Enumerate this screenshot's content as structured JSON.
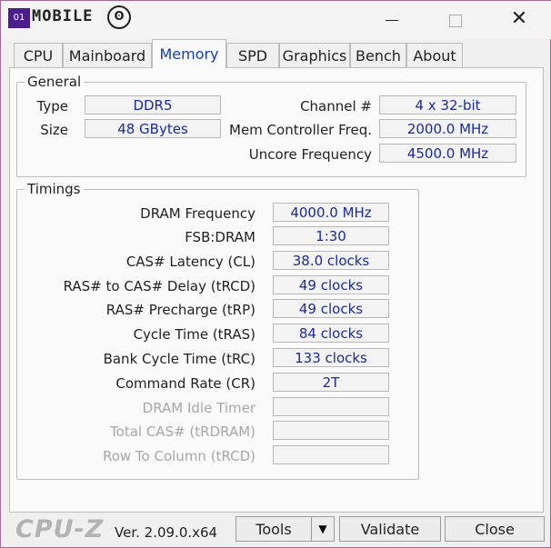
{
  "titlebar": {
    "logo_text": "MOBILE",
    "logo_mark": "01",
    "ring_glyph": "ʘ",
    "min_icon": "minimize-icon",
    "max_icon": "maximize-icon",
    "close_glyph": "✕"
  },
  "tabs": [
    "CPU",
    "Mainboard",
    "Memory",
    "SPD",
    "Graphics",
    "Bench",
    "About"
  ],
  "general": {
    "title": "General",
    "type_label": "Type",
    "type_value": "DDR5",
    "size_label": "Size",
    "size_value": "48 GBytes",
    "channel_label": "Channel #",
    "channel_value": "4 x 32-bit",
    "mcf_label": "Mem Controller Freq.",
    "mcf_value": "2000.0 MHz",
    "uncore_label": "Uncore Frequency",
    "uncore_value": "4500.0 MHz"
  },
  "timings": {
    "title": "Timings",
    "rows": [
      {
        "label": "DRAM Frequency",
        "value": "4000.0 MHz",
        "enabled": true
      },
      {
        "label": "FSB:DRAM",
        "value": "1:30",
        "enabled": true
      },
      {
        "label": "CAS# Latency (CL)",
        "value": "38.0 clocks",
        "enabled": true
      },
      {
        "label": "RAS# to CAS# Delay (tRCD)",
        "value": "49 clocks",
        "enabled": true
      },
      {
        "label": "RAS# Precharge (tRP)",
        "value": "49 clocks",
        "enabled": true
      },
      {
        "label": "Cycle Time (tRAS)",
        "value": "84 clocks",
        "enabled": true
      },
      {
        "label": "Bank Cycle Time (tRC)",
        "value": "133 clocks",
        "enabled": true
      },
      {
        "label": "Command Rate (CR)",
        "value": "2T",
        "enabled": true
      },
      {
        "label": "DRAM Idle Timer",
        "value": "",
        "enabled": false
      },
      {
        "label": "Total CAS# (tRDRAM)",
        "value": "",
        "enabled": false
      },
      {
        "label": "Row To Column (tRCD)",
        "value": "",
        "enabled": false
      }
    ]
  },
  "footer": {
    "brand": "CPU-Z",
    "version": "Ver. 2.09.0.x64",
    "tools_label": "Tools",
    "dropdown_glyph": "▼",
    "validate_label": "Validate",
    "close_label": "Close"
  }
}
